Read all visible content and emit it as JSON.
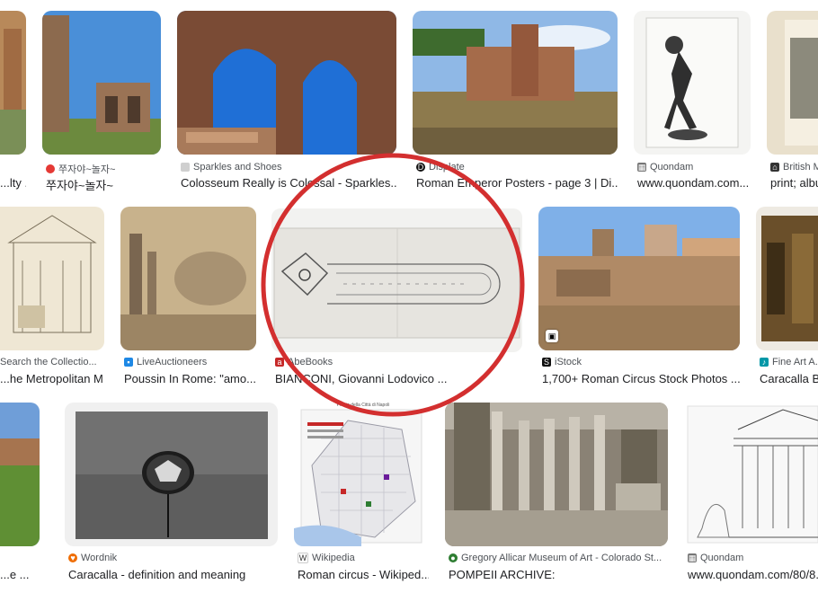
{
  "results": [
    {
      "source": "",
      "title": "...lty ...",
      "icon": "generic-site-icon",
      "color": "#bdbdbd"
    },
    {
      "source": "쭈자야~놀자~",
      "title": "쭈자야~놀자~",
      "icon": "red-dot-icon",
      "color": "#e53935"
    },
    {
      "source": "Sparkles and Shoes",
      "title": "Colosseum Really is Colossal - Sparkles...",
      "icon": "generic-site-icon",
      "color": "#cfcfcf"
    },
    {
      "source": "Displate",
      "title": "Roman Emperor Posters - page 3 | Di...",
      "icon": "displate-icon",
      "color": "#111111"
    },
    {
      "source": "Quondam",
      "title": "www.quondam.com...",
      "icon": "quondam-icon",
      "color": "#555555"
    },
    {
      "source": "British M...",
      "title": "print; albu...",
      "icon": "museum-icon",
      "color": "#333333"
    },
    {
      "source": "Search the Collectio...",
      "title": "...he Metropolitan M...",
      "icon": "generic-site-icon",
      "color": "#bdbdbd"
    },
    {
      "source": "LiveAuctioneers",
      "title": "Poussin In Rome: \"amo...",
      "icon": "liveauctioneers-icon",
      "color": "#1e88e5"
    },
    {
      "source": "AbeBooks",
      "title": "BIANCONI, Giovanni Lodovico ...",
      "icon": "abebooks-icon",
      "color": "#c62828"
    },
    {
      "source": "iStock",
      "title": "1,700+ Roman Circus Stock Photos ...",
      "icon": "istock-icon",
      "color": "#111111"
    },
    {
      "source": "Fine Art A...",
      "title": "Caracalla B...",
      "icon": "fineart-icon",
      "color": "#0097a7"
    },
    {
      "source": "",
      "title": "...e ...",
      "icon": "generic-site-icon",
      "color": "#bdbdbd"
    },
    {
      "source": "Wordnik",
      "title": "Caracalla - definition and meaning",
      "icon": "wordnik-icon",
      "color": "#ef6c00"
    },
    {
      "source": "Wikipedia",
      "title": "Roman circus - Wikiped...",
      "icon": "wikipedia-icon",
      "color": "#333333"
    },
    {
      "source": "Gregory Allicar Museum of Art - Colorado St...",
      "title": "POMPEII ARCHIVE:",
      "icon": "museum-leaf-icon",
      "color": "#2e7d32"
    },
    {
      "source": "Quondam",
      "title": "www.quondam.com/80/8...",
      "icon": "quondam-icon",
      "color": "#555555"
    }
  ],
  "map_header": "Pianta della Città di Napoli",
  "annotation": {
    "color": "#d32f2f"
  }
}
